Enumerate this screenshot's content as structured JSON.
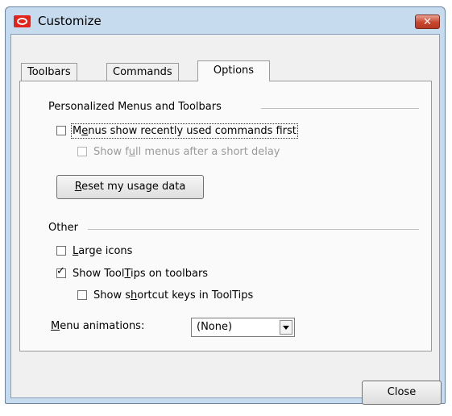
{
  "window": {
    "title": "Customize",
    "icon": "oracle-logo-icon",
    "close_glyph": "✕"
  },
  "tabs": [
    {
      "label": "Toolbars",
      "active": false
    },
    {
      "label": "Commands",
      "active": false
    },
    {
      "label": "Options",
      "active": true
    }
  ],
  "personalized": {
    "heading": "Personalized Menus and Toolbars",
    "recent_first": {
      "pre": "M",
      "u": "e",
      "post": "nus show recently used commands first",
      "checked": false
    },
    "full_menus": {
      "pre": "Show f",
      "u": "u",
      "post": "ll menus after a short delay",
      "checked": false,
      "disabled": true
    },
    "reset": {
      "u": "R",
      "post": "eset my usage data"
    }
  },
  "other": {
    "heading": "Other",
    "large_icons": {
      "u": "L",
      "post": "arge icons",
      "checked": false
    },
    "show_tooltips": {
      "pre": "Show Tool",
      "u": "T",
      "post": "ips on toolbars",
      "checked": true
    },
    "shortcut_keys": {
      "pre": "Show s",
      "u": "h",
      "post": "ortcut keys in ToolTips",
      "checked": false
    },
    "menu_animations": {
      "u": "M",
      "post": "enu animations:",
      "value": "(None)"
    }
  },
  "footer": {
    "close_label": "Close"
  },
  "colors": {
    "title_bar": "#c7dbef",
    "close_button": "#c9452d",
    "panel": "#fafafa"
  }
}
